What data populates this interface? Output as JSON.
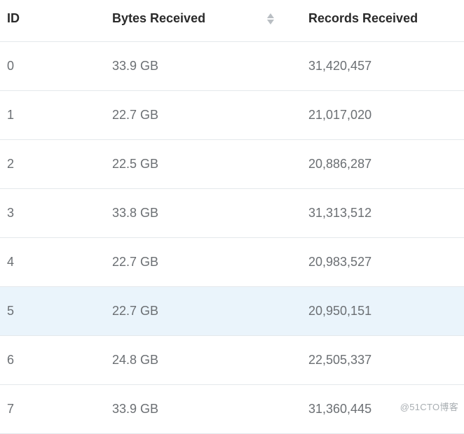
{
  "columns": {
    "id": "ID",
    "bytes": "Bytes Received",
    "records": "Records Received"
  },
  "rows": [
    {
      "id": "0",
      "bytes": "33.9 GB",
      "records": "31,420,457",
      "highlight": false
    },
    {
      "id": "1",
      "bytes": "22.7 GB",
      "records": "21,017,020",
      "highlight": false
    },
    {
      "id": "2",
      "bytes": "22.5 GB",
      "records": "20,886,287",
      "highlight": false
    },
    {
      "id": "3",
      "bytes": "33.8 GB",
      "records": "31,313,512",
      "highlight": false
    },
    {
      "id": "4",
      "bytes": "22.7 GB",
      "records": "20,983,527",
      "highlight": false
    },
    {
      "id": "5",
      "bytes": "22.7 GB",
      "records": "20,950,151",
      "highlight": true
    },
    {
      "id": "6",
      "bytes": "24.8 GB",
      "records": "22,505,337",
      "highlight": false
    },
    {
      "id": "7",
      "bytes": "33.9 GB",
      "records": "31,360,445",
      "highlight": false
    }
  ],
  "watermark": "@51CTO博客"
}
